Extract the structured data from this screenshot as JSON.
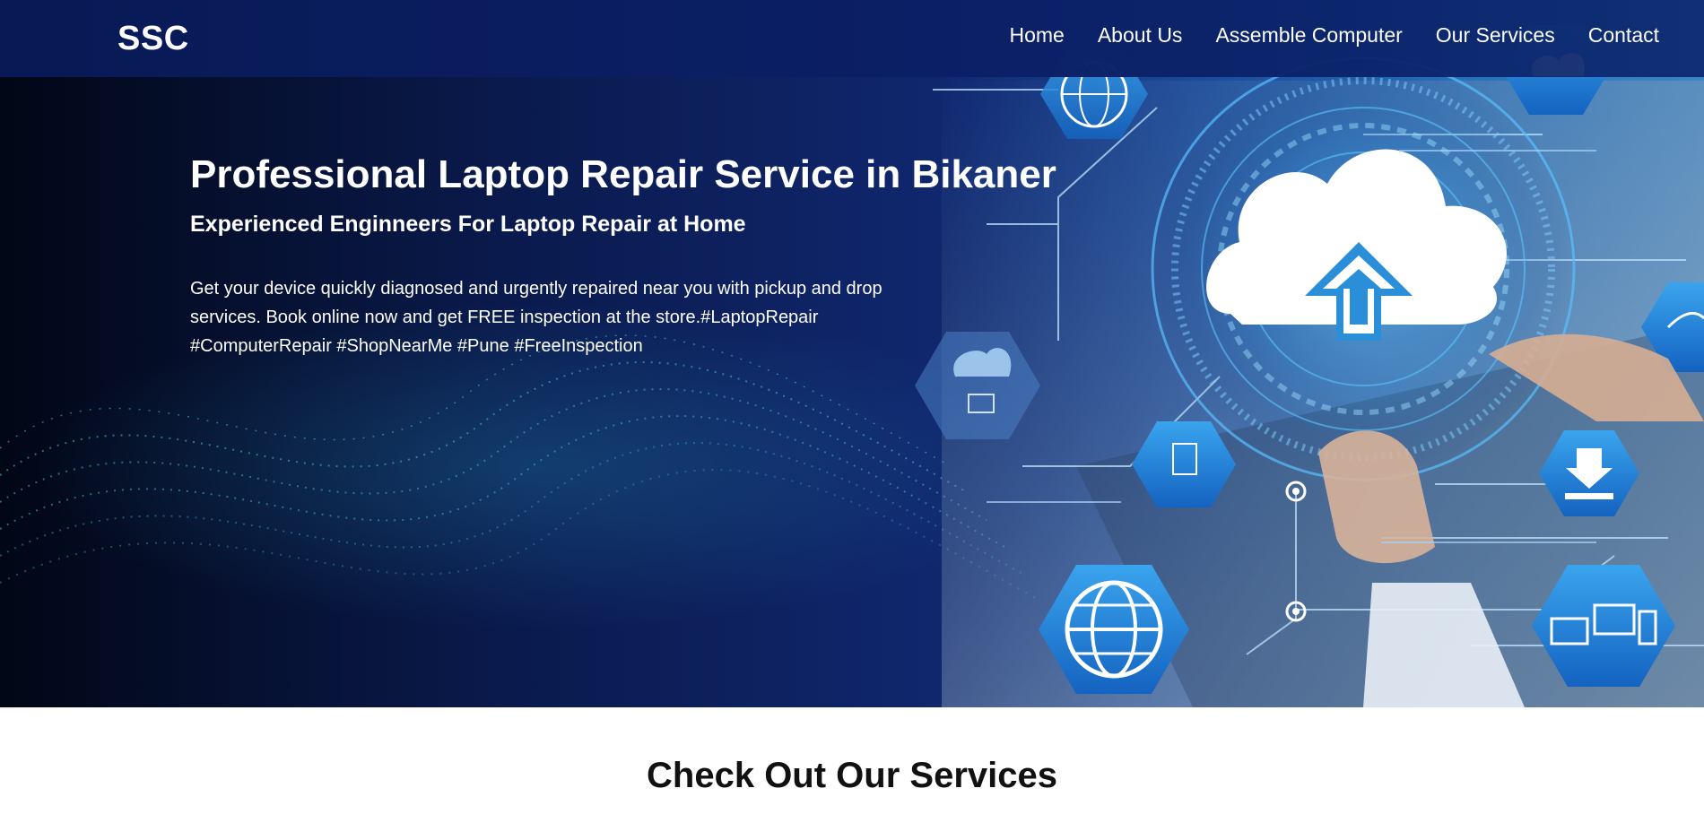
{
  "header": {
    "brand": "SSC",
    "nav": [
      "Home",
      "About Us",
      "Assemble Computer",
      "Our Services",
      "Contact"
    ]
  },
  "hero": {
    "title": "Professional Laptop Repair Service in Bikaner",
    "subtitle": "Experienced Enginneers For Laptop Repair at Home",
    "description": "Get your device quickly diagnosed and urgently repaired near you with pickup and drop services. Book online now and get FREE inspection at the store.#LaptopRepair #ComputerRepair #ShopNearMe #Pune #FreeInspection"
  },
  "services": {
    "title": "Check Out Our Services"
  },
  "icons": [
    "globe-icon",
    "cloud-upload-icon",
    "download-icon",
    "devices-icon",
    "cloud-network-icon",
    "wifi-icon"
  ],
  "colors": {
    "header_bg": "#0b1f66",
    "hero_dark": "#0a1a4d",
    "hero_accent": "#2a8fd8",
    "text_light": "#ffffff",
    "text_dark": "#111111"
  }
}
